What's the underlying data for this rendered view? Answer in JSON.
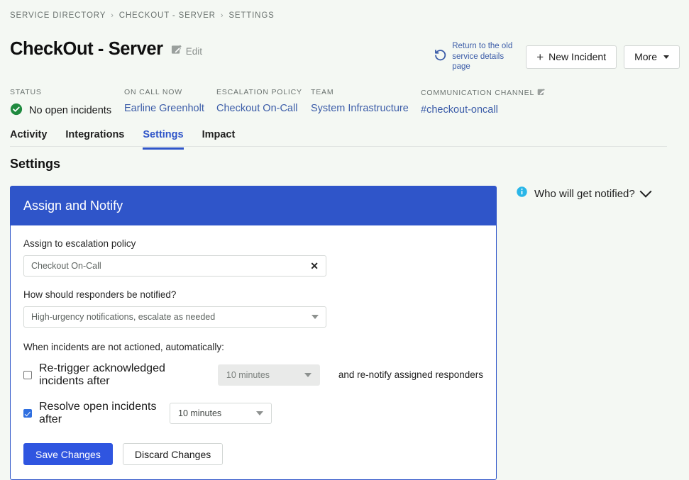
{
  "breadcrumb": {
    "items": [
      "SERVICE DIRECTORY",
      "CHECKOUT - SERVER",
      "SETTINGS"
    ],
    "separator": "›"
  },
  "header": {
    "title": "CheckOut - Server",
    "edit_label": "Edit",
    "edit_icon": "pencil-square-icon",
    "return_link": {
      "line1": "Return to the old",
      "line2": "service details page",
      "icon": "undo-circular-arrow-icon"
    },
    "new_incident_label": "New Incident",
    "new_incident_icon": "plus-icon",
    "more_label": "More",
    "more_icon": "caret-down-icon"
  },
  "meta": [
    {
      "label": "STATUS",
      "value": "No open incidents",
      "icon": "check-circle-icon",
      "type": "status"
    },
    {
      "label": "ON CALL NOW",
      "value": "Earline Greenholt",
      "type": "link"
    },
    {
      "label": "ESCALATION POLICY",
      "value": "Checkout On-Call",
      "type": "link"
    },
    {
      "label": "TEAM",
      "value": "System Infrastructure",
      "type": "link"
    },
    {
      "label": "COMMUNICATION CHANNEL",
      "value": "#checkout-oncall",
      "type": "link",
      "label_icon": "pencil-square-icon"
    }
  ],
  "tabs": [
    {
      "label": "Activity",
      "active": false
    },
    {
      "label": "Integrations",
      "active": false
    },
    {
      "label": "Settings",
      "active": true
    },
    {
      "label": "Impact",
      "active": false
    }
  ],
  "section": {
    "heading": "Settings"
  },
  "card": {
    "header_title": "Assign and Notify",
    "escalation": {
      "label": "Assign to escalation policy",
      "value": "Checkout On-Call",
      "clear_icon": "close-x-icon"
    },
    "notify": {
      "label": "How should responders be notified?",
      "value": "High-urgency notifications, escalate as needed"
    },
    "auto_label": "When incidents are not actioned, automatically:",
    "retrigger": {
      "checked": false,
      "label": "Re-trigger acknowledged incidents after",
      "duration": "10 minutes",
      "trailing": "and re-notify assigned responders"
    },
    "resolve": {
      "checked": true,
      "label": "Resolve open incidents after",
      "duration": "10 minutes"
    },
    "save_label": "Save Changes",
    "discard_label": "Discard Changes"
  },
  "notified_panel": {
    "label": "Who will get notified?",
    "info_icon": "info-circle-icon",
    "chevron_icon": "chevron-down-icon"
  },
  "colors": {
    "page_bg": "#f4f8f3",
    "accent_blue": "#2f55c9",
    "link_blue": "#3b5ca8",
    "status_green": "#1f8a3f",
    "info_cyan": "#29b6e8"
  }
}
